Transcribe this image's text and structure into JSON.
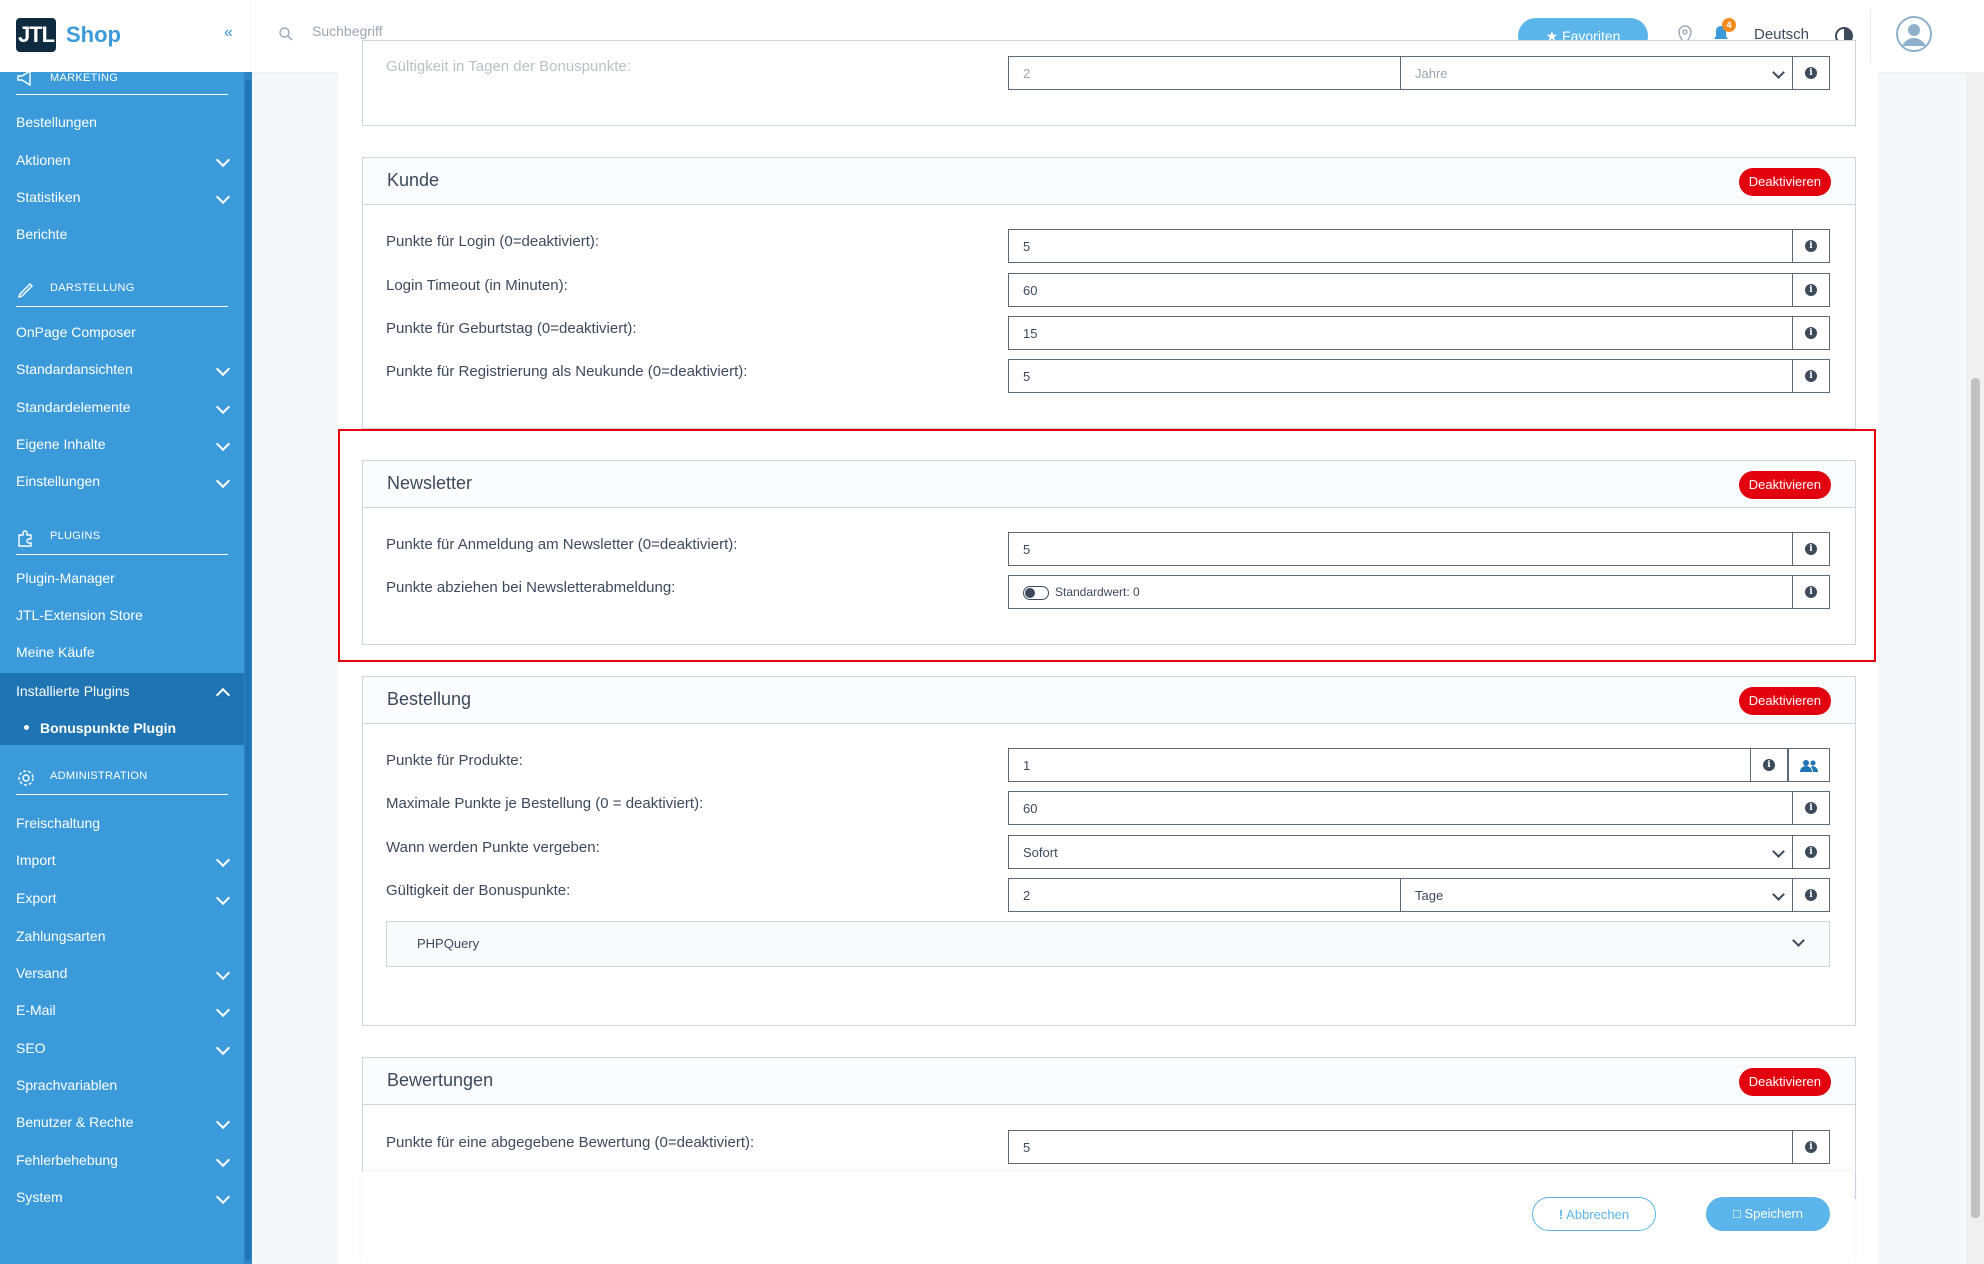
{
  "app": {
    "logo_text": "JTL",
    "logo_suffix": "Shop"
  },
  "header": {
    "search_placeholder": "Suchbegriff",
    "favorites_label": "Favoriten",
    "notification_count": "4",
    "language": "Deutsch"
  },
  "sidebar": {
    "sections": {
      "marketing": "MARKETING",
      "darstellung": "DARSTELLUNG",
      "plugins": "PLUGINS",
      "administration": "ADMINISTRATION"
    },
    "items": {
      "bestellungen": "Bestellungen",
      "aktionen": "Aktionen",
      "statistiken": "Statistiken",
      "berichte": "Berichte",
      "onpage": "OnPage Composer",
      "standardansichten": "Standardansichten",
      "standardelemente": "Standardelemente",
      "eigene_inhalte": "Eigene Inhalte",
      "einstellungen": "Einstellungen",
      "plugin_manager": "Plugin-Manager",
      "extension_store": "JTL-Extension Store",
      "meine_kaeufe": "Meine Käufe",
      "installierte_plugins": "Installierte Plugins",
      "bonuspunkte_plugin": "Bonuspunkte Plugin",
      "freischaltung": "Freischaltung",
      "import": "Import",
      "export": "Export",
      "zahlungsarten": "Zahlungsarten",
      "versand": "Versand",
      "email": "E-Mail",
      "seo": "SEO",
      "sprachvariablen": "Sprachvariablen",
      "benutzer": "Benutzer & Rechte",
      "fehlerbehebung": "Fehlerbehebung",
      "system": "System"
    }
  },
  "top_partial": {
    "label": "Gültigkeit in Tagen der Bonuspunkte:",
    "value": "2",
    "unit": "Jahre"
  },
  "kunde": {
    "title": "Kunde",
    "deactivate": "Deaktivieren",
    "rows": [
      {
        "label": "Punkte für Login (0=deaktiviert):",
        "value": "5"
      },
      {
        "label": "Login Timeout (in Minuten):",
        "value": "60"
      },
      {
        "label": "Punkte für Geburtstag (0=deaktiviert):",
        "value": "15"
      },
      {
        "label": "Punkte für Registrierung als Neukunde (0=deaktiviert):",
        "value": "5"
      }
    ]
  },
  "newsletter": {
    "title": "Newsletter",
    "deactivate": "Deaktivieren",
    "rows": [
      {
        "label": "Punkte für Anmeldung am Newsletter (0=deaktiviert):",
        "value": "5"
      },
      {
        "label": "Punkte abziehen bei Newsletterabmeldung:",
        "value": "Standardwert: 0"
      }
    ]
  },
  "bestellung": {
    "title": "Bestellung",
    "deactivate": "Deaktivieren",
    "rows": [
      {
        "label": "Punkte für Produkte:",
        "value": "1"
      },
      {
        "label": "Maximale Punkte je Bestellung (0 = deaktiviert):",
        "value": "60"
      },
      {
        "label": "Wann werden Punkte vergeben:",
        "value": "Sofort"
      },
      {
        "label": "Gültigkeit der Bonuspunkte:",
        "value": "2",
        "unit": "Tage"
      }
    ],
    "accordion": "PHPQuery"
  },
  "bewertungen": {
    "title": "Bewertungen",
    "deactivate": "Deaktivieren",
    "rows": [
      {
        "label": "Punkte für eine abgegebene Bewertung (0=deaktiviert):",
        "value": "5"
      }
    ]
  },
  "footer": {
    "cancel": "Abbrechen",
    "save": "Speichern"
  },
  "colors": {
    "sidebar": "#3b9ad9",
    "active": "#1f74b3",
    "danger": "#e3000f",
    "accent": "#5bb4ea"
  }
}
